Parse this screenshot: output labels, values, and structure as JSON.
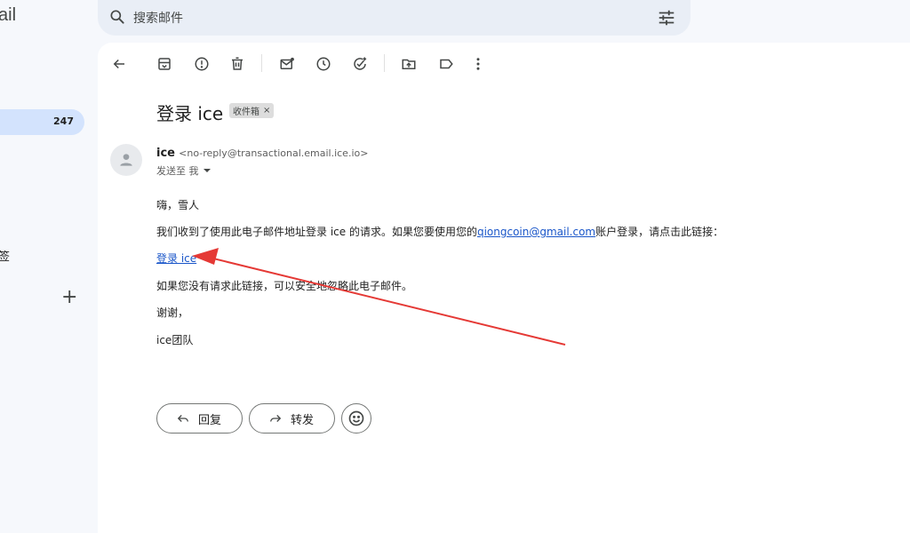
{
  "app": {
    "title_partial": "ail"
  },
  "nav": {
    "inbox_count": "247",
    "partial_label": "签",
    "compose_plus": "+"
  },
  "search": {
    "placeholder": "搜索邮件"
  },
  "toolbar": {
    "icons": [
      "back-arrow-icon",
      "archive-icon",
      "report-spam-icon",
      "delete-icon",
      "mark-unread-icon",
      "snooze-icon",
      "add-task-icon",
      "move-to-icon",
      "label-icon",
      "more-vert-icon"
    ]
  },
  "email": {
    "subject": "登录 ice",
    "label_chip": "收件箱",
    "label_chip_close": "×",
    "sender_name": "ice",
    "sender_address": "<no-reply@transactional.email.ice.io>",
    "to_line": "发送至 我",
    "greeting": "嗨，雪人",
    "para1_before": "我们收到了使用此电子邮件地址登录 ice 的请求。如果您要使用您的",
    "para1_email": "qiongcoin@gmail.com",
    "para1_after": "账户登录，请点击此链接：",
    "login_link": "登录 ice",
    "para2": "如果您没有请求此链接，可以安全地忽略此电子邮件。",
    "thanks": "谢谢，",
    "signature": "ice团队"
  },
  "actions": {
    "reply": "回复",
    "forward": "转发"
  },
  "colors": {
    "accent": "#1a56c9",
    "annotation_arrow": "#e53935",
    "nav_selected": "#d3e3fd"
  }
}
